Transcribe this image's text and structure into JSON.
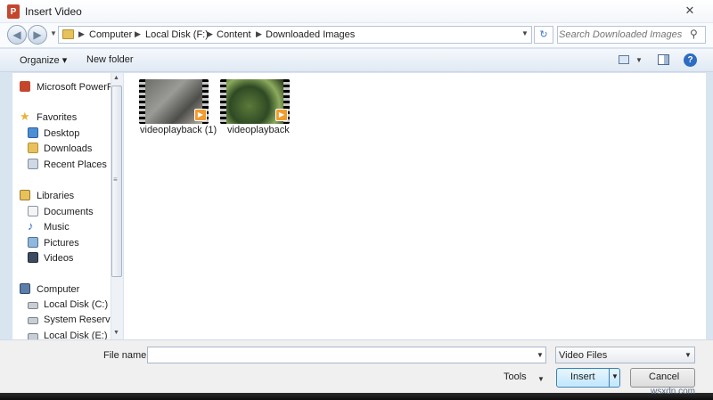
{
  "window": {
    "title": "Insert Video",
    "app_icon": "powerpoint-icon",
    "close_glyph": "✕"
  },
  "address_bar": {
    "crumbs": [
      "Computer",
      "Local Disk (F:)",
      "Content",
      "Downloaded Images"
    ],
    "search_placeholder": "Search Downloaded Images"
  },
  "toolbar": {
    "organize_label": "Organize ▾",
    "new_folder_label": "New folder"
  },
  "navigation": {
    "items": [
      {
        "label": "Microsoft PowerPoint",
        "icon": "powerpoint-icon"
      },
      {
        "label": "Favorites",
        "icon": "star-icon"
      },
      {
        "label": "Desktop",
        "icon": "desktop-icon"
      },
      {
        "label": "Downloads",
        "icon": "downloads-icon"
      },
      {
        "label": "Recent Places",
        "icon": "recent-places-icon"
      },
      {
        "label": "Libraries",
        "icon": "libraries-icon"
      },
      {
        "label": "Documents",
        "icon": "documents-icon"
      },
      {
        "label": "Music",
        "icon": "music-icon"
      },
      {
        "label": "Pictures",
        "icon": "pictures-icon"
      },
      {
        "label": "Videos",
        "icon": "videos-icon"
      },
      {
        "label": "Computer",
        "icon": "computer-icon"
      },
      {
        "label": "Local Disk (C:)",
        "icon": "drive-icon"
      },
      {
        "label": "System Reserved",
        "icon": "drive-icon"
      },
      {
        "label": "Local Disk (E:)",
        "icon": "drive-icon"
      }
    ]
  },
  "files": [
    {
      "name": "videoplayback (1)",
      "type": "video"
    },
    {
      "name": "videoplayback",
      "type": "video"
    }
  ],
  "bottom": {
    "file_name_label": "File name:",
    "file_name_value": "",
    "file_type": "Video Files",
    "tools_label": "Tools",
    "insert_label": "Insert",
    "cancel_label": "Cancel"
  },
  "watermark": "wsxdn.com",
  "colors": {
    "accent": "#3c7fb1",
    "window_frame": "#d9e4f1",
    "play_badge": "#f29b2e"
  }
}
